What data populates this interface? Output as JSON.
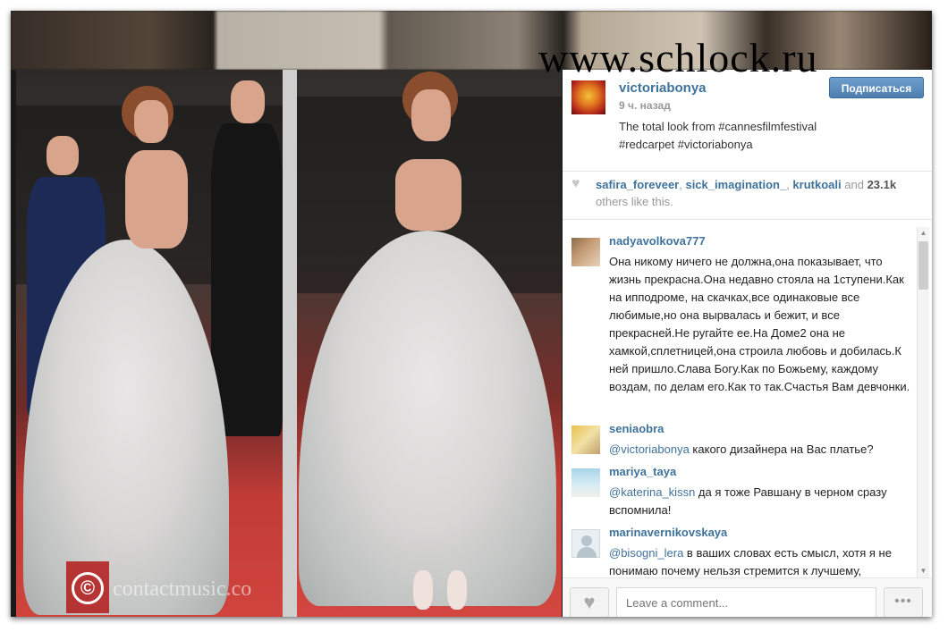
{
  "watermark": "www.schlock.ru",
  "photo": {
    "copyright_symbol": "©",
    "credit": "contactmusic.co"
  },
  "post": {
    "username": "victoriabonya",
    "time": "9 ч. назад",
    "caption": "The total look from #cannesfilmfestival #redcarpet #victoriabonya",
    "follow_label": "Подписаться"
  },
  "likes": {
    "users": [
      "safira_foreveer",
      "sick_imagination_",
      "krutkoali"
    ],
    "and_text": "and",
    "count": "23.1k",
    "suffix": "others like this."
  },
  "comments": [
    {
      "user": "nadyavolkova777",
      "text": "Она никому ничего не должна,она показывает, что жизнь прекрасна.Она недавно стояла на 1ступени.Как на ипподроме, на скачках,все одинаковые все любимые,но она вырвалась и бежит, и все прекрасней.Не ругайте ее.На Доме2 она не хамкой,сплетницей,она строила любовь и добилась.К ней пришло.Слава Богу.Как по Божьему, каждому воздам, по делам его.Как то так.Счастья Вам девчонки."
    },
    {
      "user": "seniaobra",
      "mention": "@victoriabonya",
      "text": " какого дизайнера на Вас платье?"
    },
    {
      "user": "mariya_taya",
      "mention": "@katerina_kissn",
      "text": " да я тоже Равшану в черном сразу вспомнила!"
    },
    {
      "user": "marinavernikovskaya",
      "mention": "@bisogni_lera",
      "text": " в ваших словах есть смысл, хотя я не понимаю почему нельзя стремится к лучшему,"
    }
  ],
  "footer": {
    "comment_placeholder": "Leave a comment...",
    "more_label": "•••",
    "like_icon": "♥"
  },
  "colors": {
    "link": "#3f729b",
    "follow_button": "#517fa4"
  }
}
